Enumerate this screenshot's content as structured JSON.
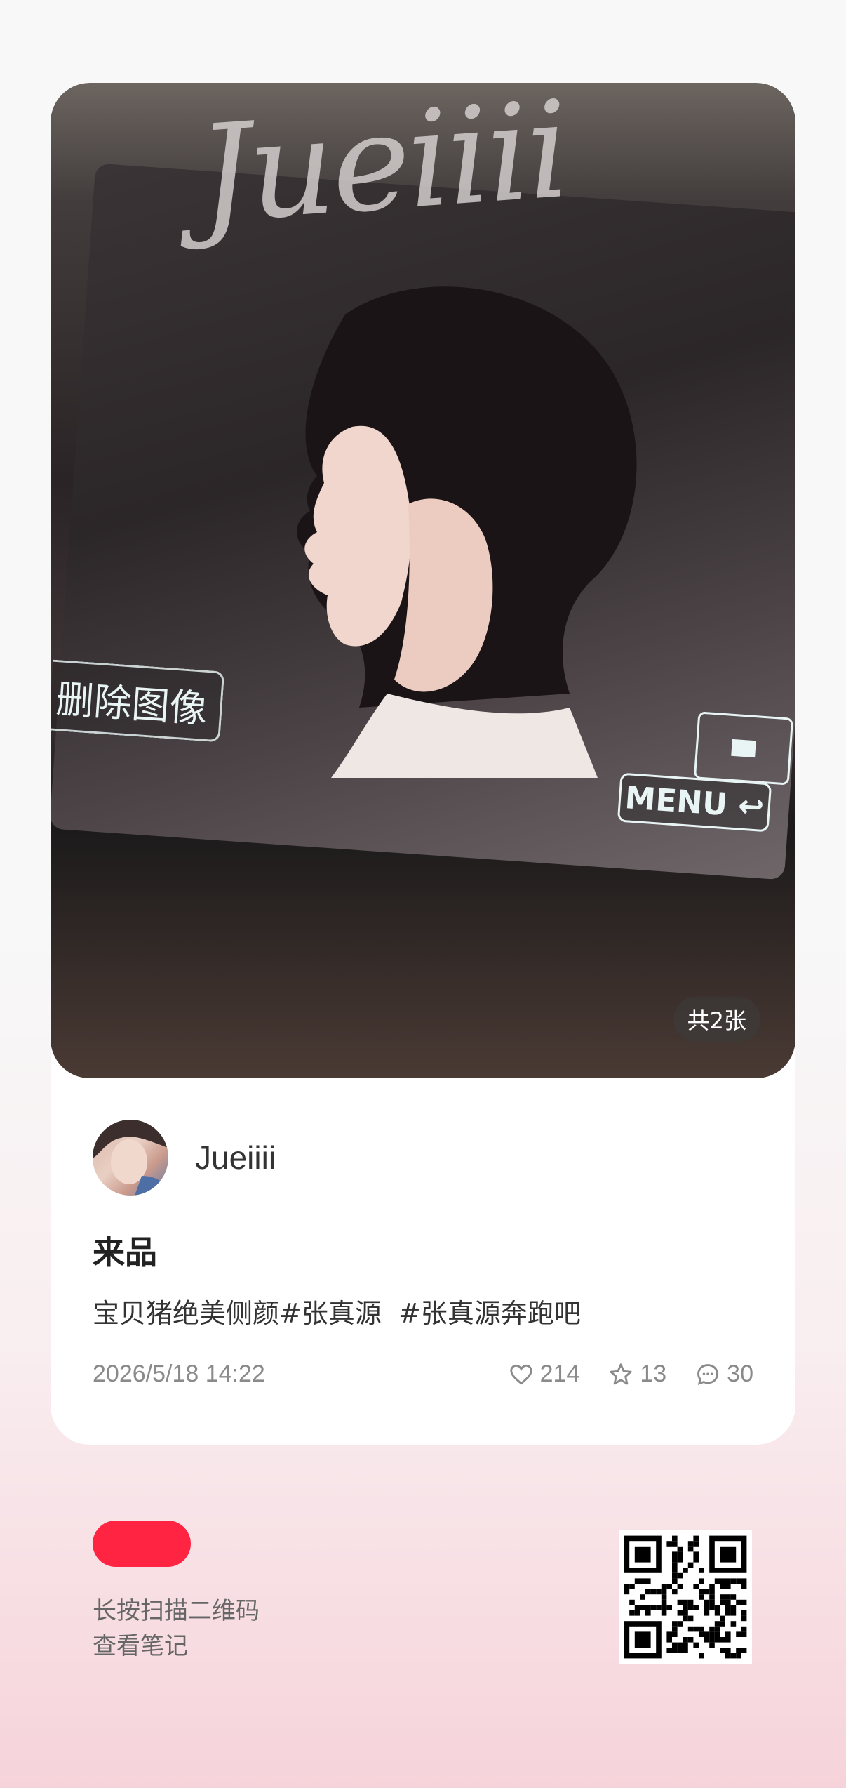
{
  "post": {
    "watermark": "Jueiiii",
    "camera_overlay": {
      "delete_label": "删除图像",
      "menu_label": "MENU ↩"
    },
    "image_count_label": "共2张",
    "author_name": "Jueiiii",
    "title": "来品",
    "description": "宝贝猪绝美侧颜#张真源  #张真源奔跑吧",
    "date": "2026/5/18 14:22",
    "likes": "214",
    "collects": "13",
    "comments": "30"
  },
  "footer": {
    "line1": "长按扫描二维码",
    "line2": "查看笔记"
  },
  "colors": {
    "brand": "#ff2442",
    "text": "#333333",
    "muted": "#8a8a8a"
  },
  "icons": [
    "heart-icon",
    "star-icon",
    "comment-icon"
  ]
}
